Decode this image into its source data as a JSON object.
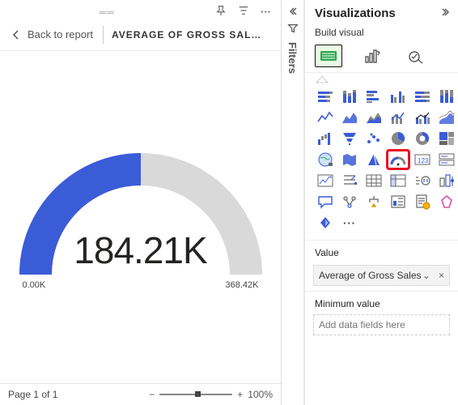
{
  "toolbar": {
    "pin": "",
    "filter": "",
    "more": ""
  },
  "header": {
    "back_label": "Back to report",
    "title": "AVERAGE OF GROSS SAL…"
  },
  "chart_data": {
    "type": "gauge",
    "value": 184210,
    "value_label": "184.21K",
    "min": 0,
    "min_label": "0.00K",
    "max": 368420,
    "max_label": "368.42K",
    "fill_color": "#3b5cd7",
    "track_color": "#d9d9d9"
  },
  "footer": {
    "page_label": "Page 1 of 1",
    "zoom_label": "100%",
    "zoom_value": 100
  },
  "filters_rail": {
    "label": "Filters"
  },
  "viz_panel": {
    "title": "Visualizations",
    "subtitle": "Build visual",
    "sections": {
      "value": {
        "label": "Value",
        "field": "Average of Gross Sales"
      },
      "min": {
        "label": "Minimum value",
        "placeholder": "Add data fields here"
      }
    },
    "more_label": "···"
  }
}
